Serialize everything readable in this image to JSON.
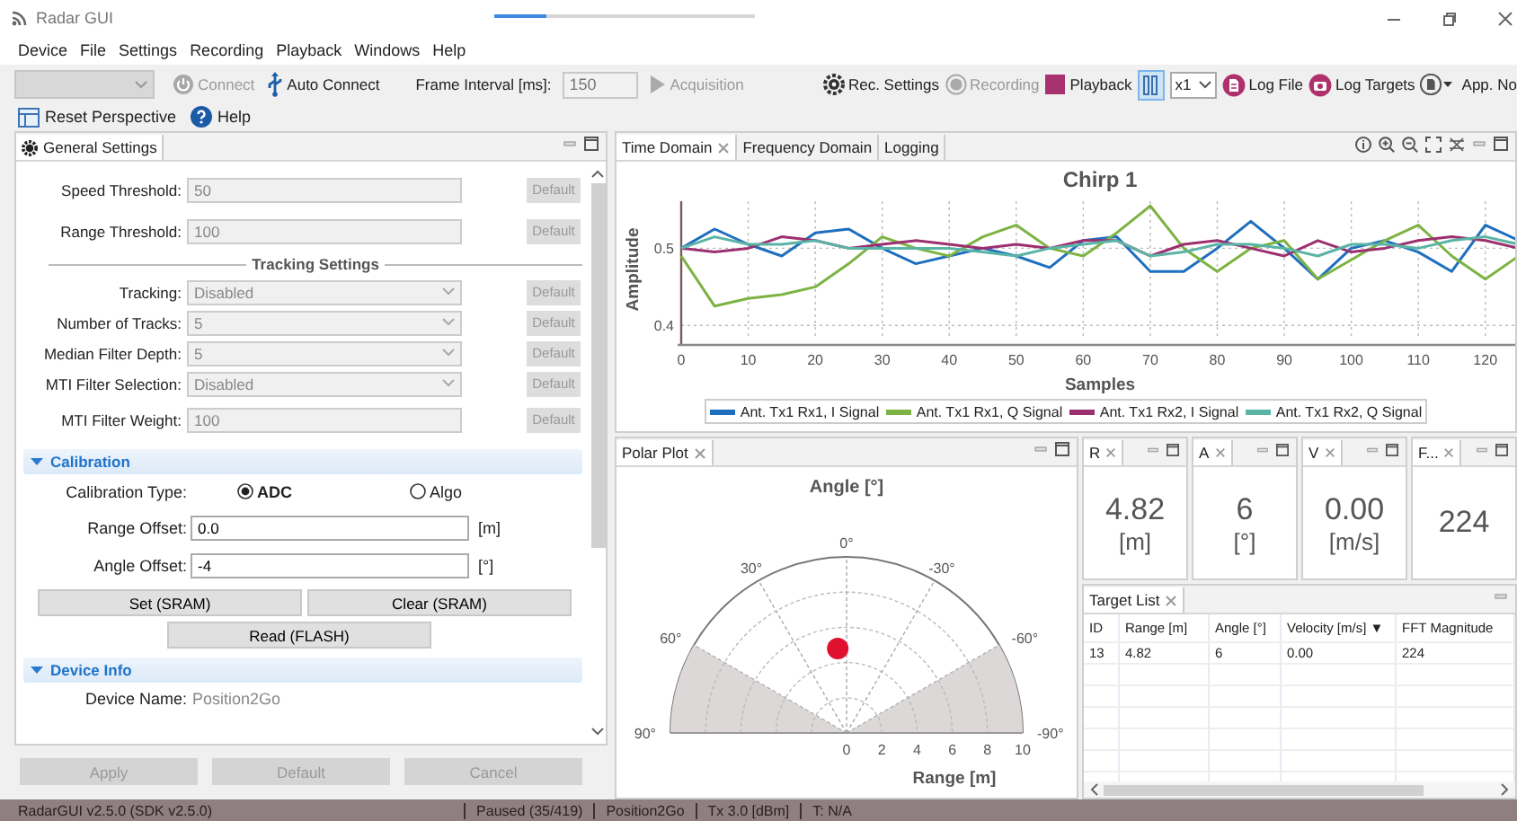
{
  "window": {
    "title": "Radar GUI",
    "loading_bar": {
      "level": 0.2
    }
  },
  "menu": [
    "Device",
    "File",
    "Settings",
    "Recording",
    "Playback",
    "Windows",
    "Help"
  ],
  "toolbar": {
    "device_select": {
      "disabled": true
    },
    "connect": {
      "label": "Connect",
      "disabled": true
    },
    "auto_connect": {
      "label": "Auto Connect",
      "disabled": false
    },
    "frame_interval": {
      "label": "Frame Interval [ms]:",
      "value": "150",
      "disabled": true
    },
    "acquisition": {
      "label": "Acquisition",
      "disabled": true
    },
    "rec_settings": {
      "label": "Rec. Settings",
      "disabled": false
    },
    "recording": {
      "label": "Recording",
      "disabled": true
    },
    "playback": {
      "label": "Playback",
      "disabled": false
    },
    "pause": {
      "selected": true
    },
    "speed": {
      "value": "x1"
    },
    "log_file": {
      "label": "Log File"
    },
    "log_targets": {
      "label": "Log Targets"
    },
    "app_notes": {
      "label": "App. No"
    }
  },
  "toolbar2": {
    "reset_perspective": "Reset Perspective",
    "help": "Help"
  },
  "settings_panel": {
    "tab": "General Settings",
    "fields": [
      {
        "kind": "input",
        "label": "Speed Threshold:",
        "value": "50",
        "disabled": true,
        "button": {
          "label": "Default",
          "disabled": true
        }
      },
      {
        "kind": "input",
        "label": "Range Threshold:",
        "value": "100",
        "disabled": true,
        "button": {
          "label": "Default",
          "disabled": true
        }
      },
      {
        "kind": "heading",
        "label": "Tracking Settings"
      },
      {
        "kind": "select",
        "label": "Tracking:",
        "value": "Disabled",
        "disabled": true,
        "button": {
          "label": "Default",
          "disabled": true
        }
      },
      {
        "kind": "select",
        "label": "Number of Tracks:",
        "value": "5",
        "disabled": true,
        "button": {
          "label": "Default",
          "disabled": true
        }
      },
      {
        "kind": "select",
        "label": "Median Filter Depth:",
        "value": "5",
        "disabled": true,
        "button": {
          "label": "Default",
          "disabled": true
        }
      },
      {
        "kind": "select",
        "label": "MTI Filter Selection:",
        "value": "Disabled",
        "disabled": true,
        "button": {
          "label": "Default",
          "disabled": true
        }
      },
      {
        "kind": "input",
        "label": "MTI Filter Weight:",
        "value": "100",
        "disabled": true,
        "button": {
          "label": "Default",
          "disabled": true
        }
      }
    ],
    "calibration": {
      "title": "Calibration",
      "expanded": true,
      "type_label": "Calibration Type:",
      "options": [
        {
          "label": "ADC",
          "selected": true
        },
        {
          "label": "Algo",
          "selected": false
        }
      ],
      "offsets": [
        {
          "label": "Range Offset:",
          "value": "0.0",
          "unit": "[m]"
        },
        {
          "label": "Angle Offset:",
          "value": "-4",
          "unit": "[°]"
        }
      ],
      "buttons": [
        "Set (SRAM)",
        "Clear (SRAM)",
        "Read (FLASH)"
      ]
    },
    "device_info": {
      "title": "Device Info",
      "expanded": true,
      "rows": [
        {
          "label": "Device Name:",
          "value": "Position2Go"
        }
      ]
    },
    "actions": [
      {
        "label": "Apply",
        "disabled": true
      },
      {
        "label": "Default",
        "disabled": true
      },
      {
        "label": "Cancel",
        "disabled": true
      }
    ]
  },
  "time_panel": {
    "tabs": [
      {
        "label": "Time Domain",
        "selected": true
      },
      {
        "label": "Frequency Domain",
        "selected": false
      },
      {
        "label": "Logging",
        "selected": false
      }
    ],
    "chart_data": {
      "type": "line",
      "title": "Chirp 1",
      "xlabel": "Samples",
      "ylabel": "Amplitude",
      "xlim": [
        0,
        125
      ],
      "ylim": [
        0.384,
        0.561
      ],
      "grid": true,
      "legend": "bottom",
      "xticks": [
        0,
        10,
        20,
        30,
        40,
        50,
        60,
        70,
        80,
        90,
        100,
        110,
        120
      ],
      "yticks": [
        0.4,
        0.5
      ],
      "x": [
        0,
        5,
        10,
        15,
        20,
        25,
        30,
        35,
        40,
        45,
        50,
        55,
        60,
        65,
        70,
        75,
        80,
        85,
        90,
        95,
        100,
        105,
        110,
        115,
        120,
        125
      ],
      "series": [
        {
          "name": "Ant. Tx1 Rx1, I Signal",
          "color": "#1f6fbf",
          "values": [
            0.5,
            0.525,
            0.505,
            0.49,
            0.52,
            0.525,
            0.5,
            0.48,
            0.49,
            0.5,
            0.49,
            0.475,
            0.51,
            0.515,
            0.47,
            0.47,
            0.5,
            0.535,
            0.5,
            0.46,
            0.5,
            0.51,
            0.495,
            0.47,
            0.53,
            0.51
          ]
        },
        {
          "name": "Ant. Tx1 Rx1, Q Signal",
          "color": "#7cb342",
          "values": [
            0.49,
            0.425,
            0.435,
            0.44,
            0.45,
            0.48,
            0.515,
            0.5,
            0.49,
            0.515,
            0.53,
            0.5,
            0.49,
            0.52,
            0.555,
            0.5,
            0.47,
            0.5,
            0.51,
            0.46,
            0.485,
            0.51,
            0.53,
            0.49,
            0.46,
            0.49
          ]
        },
        {
          "name": "Ant. Tx1 Rx2, I Signal",
          "color": "#9c2f6f",
          "values": [
            0.5,
            0.495,
            0.5,
            0.515,
            0.51,
            0.5,
            0.505,
            0.51,
            0.505,
            0.5,
            0.505,
            0.5,
            0.51,
            0.51,
            0.49,
            0.505,
            0.51,
            0.5,
            0.49,
            0.51,
            0.495,
            0.5,
            0.51,
            0.515,
            0.51,
            0.5
          ]
        },
        {
          "name": "Ant. Tx1 Rx2, Q Signal",
          "color": "#5ab4a6",
          "values": [
            0.5,
            0.515,
            0.505,
            0.505,
            0.51,
            0.5,
            0.5,
            0.5,
            0.5,
            0.495,
            0.49,
            0.5,
            0.505,
            0.51,
            0.49,
            0.495,
            0.505,
            0.505,
            0.5,
            0.49,
            0.505,
            0.505,
            0.5,
            0.51,
            0.515,
            0.505
          ]
        }
      ]
    }
  },
  "polar_panel": {
    "tab": "Polar Plot",
    "title": "Angle [°]",
    "angle_labels": [
      "0°",
      "30°",
      "-30°",
      "60°",
      "-60°",
      "90°",
      "-90°"
    ],
    "range_ticks": [
      "0",
      "2",
      "4",
      "6",
      "8",
      "10"
    ],
    "range_label": "Range [m]"
  },
  "value_panels": [
    {
      "tab": "R",
      "value": "4.82",
      "unit": "[m]"
    },
    {
      "tab": "A",
      "value": "6",
      "unit": "[°]"
    },
    {
      "tab": "V",
      "value": "0.00",
      "unit": "[m/s]"
    },
    {
      "tab": "F...",
      "value": "224"
    }
  ],
  "target_list": {
    "tab": "Target List",
    "columns": [
      "ID",
      "Range [m]",
      "Angle [°]",
      "Velocity [m/s] ▼",
      "FFT Magnitude"
    ],
    "rows": [
      [
        "13",
        "4.82",
        "6",
        "0.00",
        "224"
      ]
    ]
  },
  "status_bar": [
    "RadarGUI v2.5.0 (SDK v2.5.0)",
    "Paused (35/419)",
    "Position2Go",
    "Tx 3.0 [dBm]",
    "T: N/A"
  ]
}
